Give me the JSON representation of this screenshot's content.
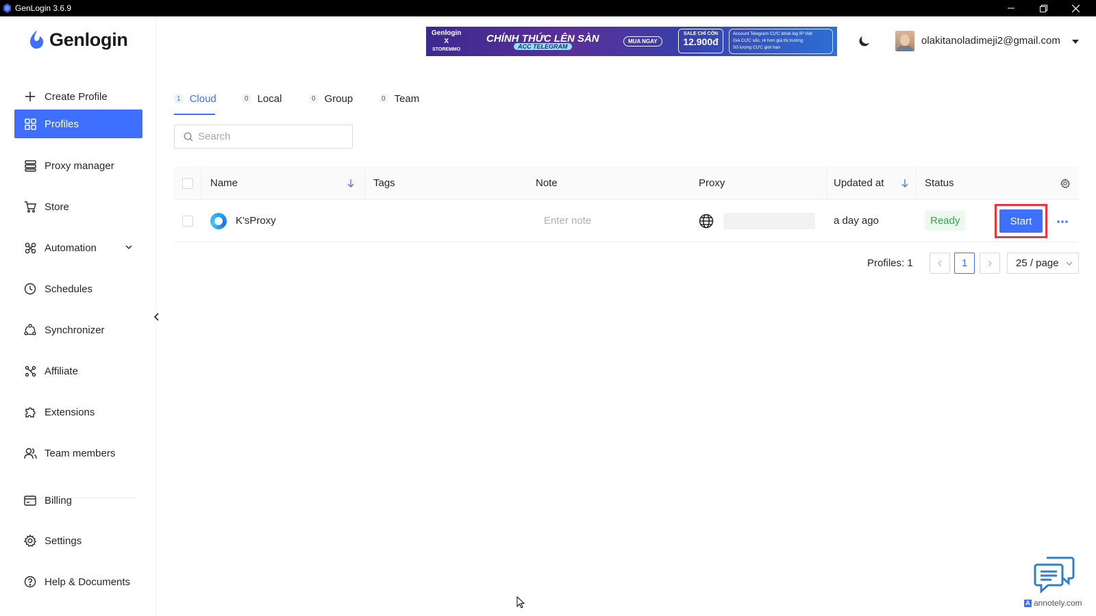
{
  "window": {
    "title": "GenLogin 3.6.9"
  },
  "app": {
    "logo_text": "Genlogin",
    "brand_color": "#3f6fff"
  },
  "sidebar": {
    "create_label": "Create Profile",
    "items": [
      {
        "label": "Profiles",
        "icon": "grid-icon",
        "active": true
      },
      {
        "label": "Proxy manager",
        "icon": "server-icon"
      },
      {
        "label": "Store",
        "icon": "cart-icon"
      },
      {
        "label": "Automation",
        "icon": "automation-icon"
      },
      {
        "label": "Schedules",
        "icon": "clock-icon"
      },
      {
        "label": "Synchronizer",
        "icon": "sync-icon"
      },
      {
        "label": "Affiliate",
        "icon": "affiliate-icon"
      },
      {
        "label": "Extensions",
        "icon": "puzzle-icon"
      },
      {
        "label": "Team members",
        "icon": "users-icon"
      },
      {
        "label": "Billing",
        "icon": "card-icon"
      },
      {
        "label": "Settings",
        "icon": "gear-icon"
      },
      {
        "label": "Help & Documents",
        "icon": "help-icon"
      }
    ]
  },
  "banner": {
    "brand_top": "Genlogin",
    "brand_x": "X",
    "brand_bottom": "STOREMMO",
    "headline": "CHÍNH THỨC LÊN SÀN",
    "sub": "ACC TELEGRAM",
    "cta": "MUA NGAY",
    "price_label": "SALE CHỈ CÒN",
    "price": "12.900đ",
    "bullets": [
      "Account Telegram CỰC khoẻ log IP Việt",
      "Giá CỰC sốc, rẻ hơn giá thị trường",
      "Số lượng CỰC giới hạn"
    ]
  },
  "header": {
    "user_email": "olakitanoladimeji2@gmail.com"
  },
  "tabs": [
    {
      "count": "1",
      "label": "Cloud",
      "active": true
    },
    {
      "count": "0",
      "label": "Local"
    },
    {
      "count": "0",
      "label": "Group"
    },
    {
      "count": "0",
      "label": "Team"
    }
  ],
  "search": {
    "placeholder": "Search",
    "value": ""
  },
  "table": {
    "columns": {
      "name": "Name",
      "tags": "Tags",
      "note": "Note",
      "proxy": "Proxy",
      "updated": "Updated at",
      "status": "Status"
    },
    "rows": [
      {
        "name": "K'sProxy",
        "tags": "",
        "note_placeholder": "Enter note",
        "updated": "a day ago",
        "status": "Ready",
        "action": "Start"
      }
    ]
  },
  "pagination": {
    "total_label": "Profiles: 1",
    "current_page": "1",
    "page_size": "25 / page"
  },
  "watermark": {
    "text": "annotely.com"
  },
  "colors": {
    "accent": "#3f6fff",
    "status_ready": "#3aa34a",
    "highlight": "#ee3340"
  }
}
